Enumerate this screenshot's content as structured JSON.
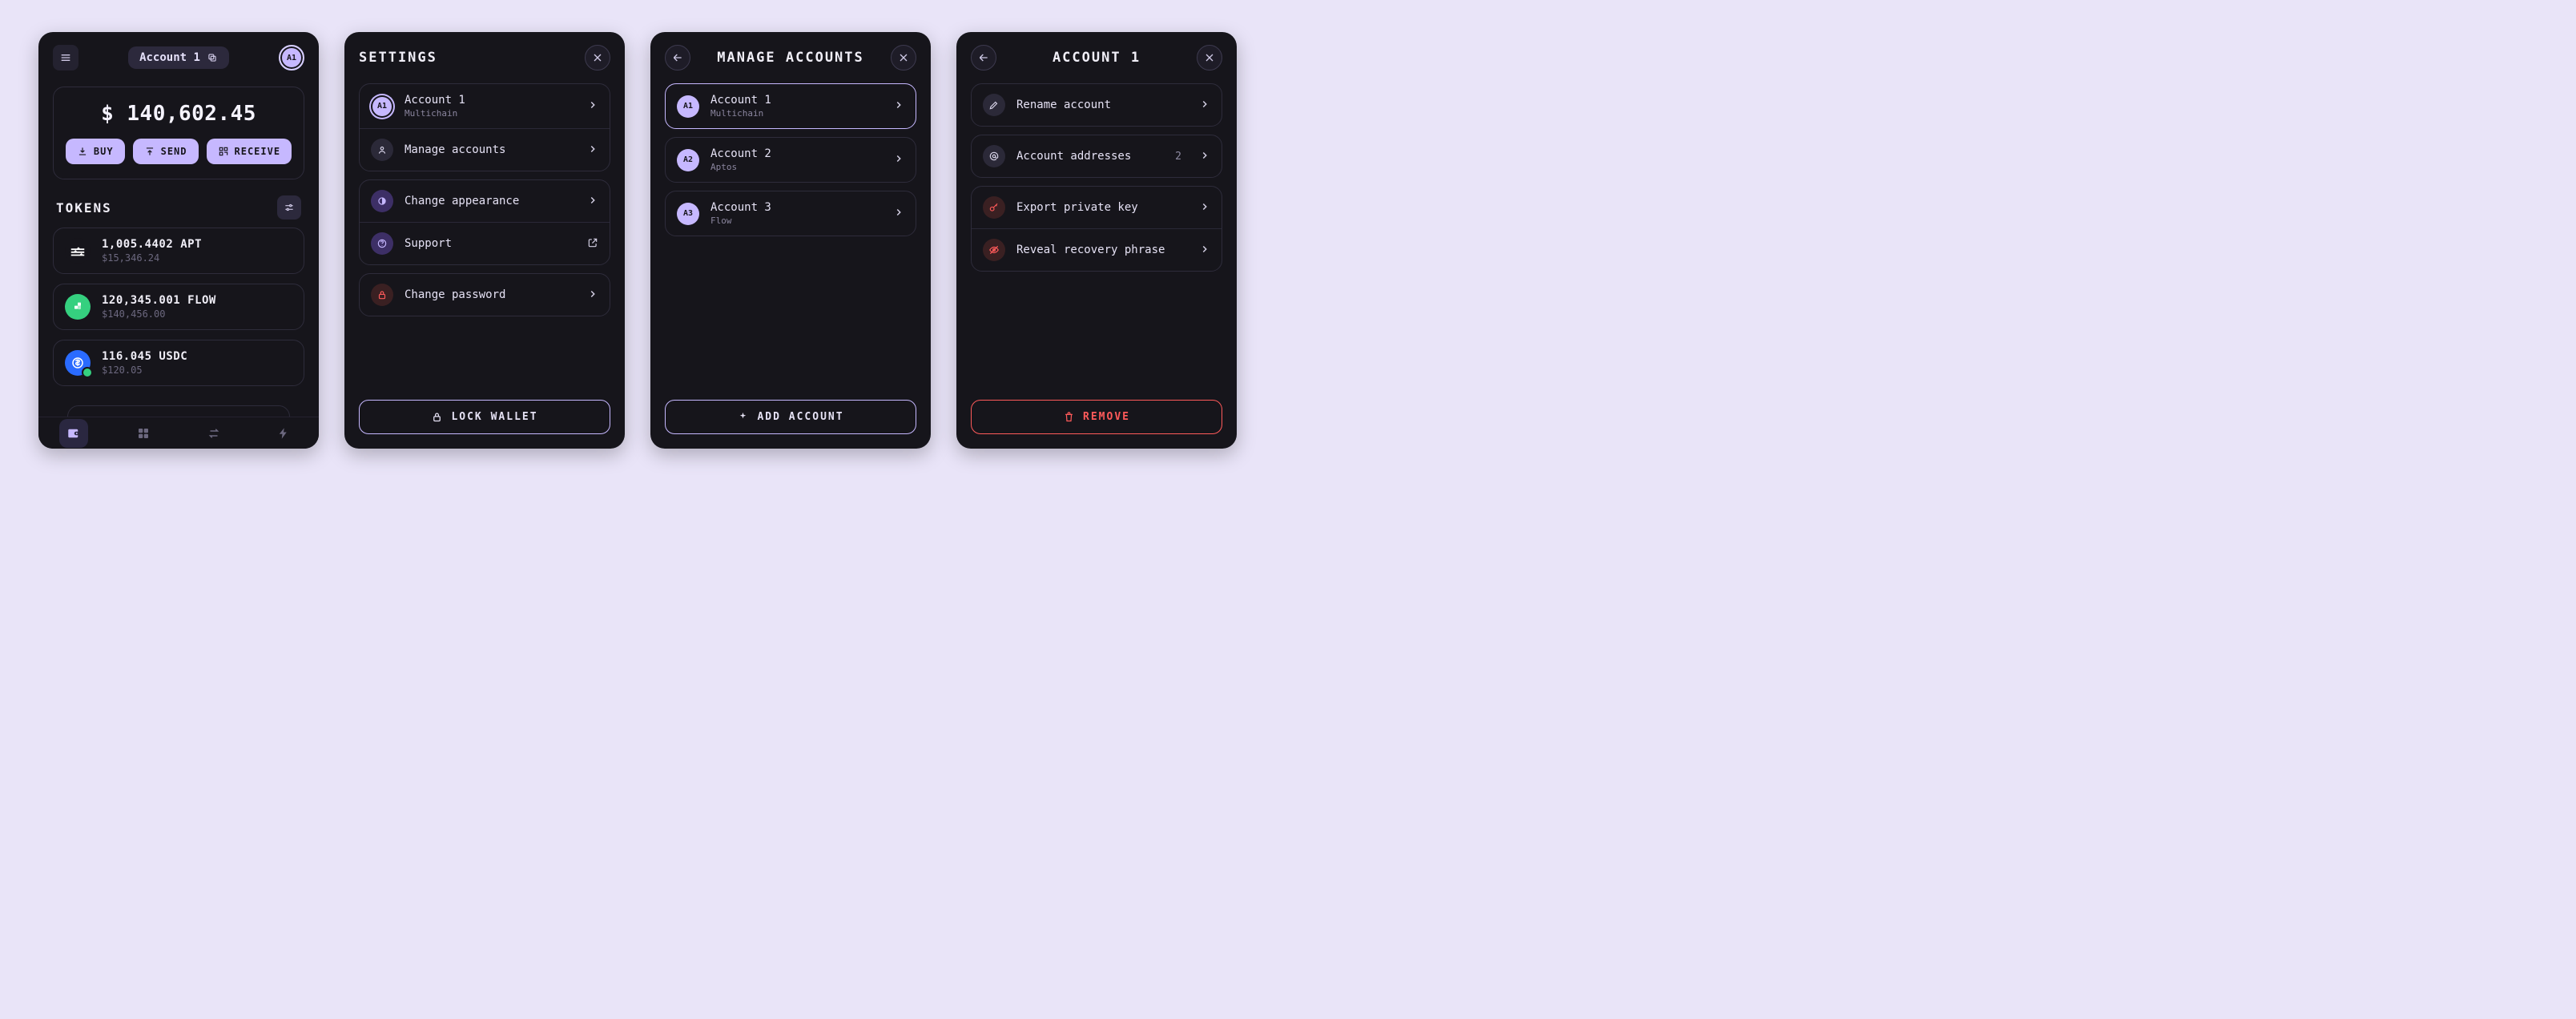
{
  "home": {
    "account_chip": "Account 1",
    "avatar": "A1",
    "balance": "$ 140,602.45",
    "buy": "BUY",
    "send": "SEND",
    "receive": "RECEIVE",
    "tokens_title": "TOKENS",
    "tokens": [
      {
        "amount": "1,005.4402 APT",
        "fiat": "$15,346.24",
        "bg": "#16151b",
        "fg": "#ffffff"
      },
      {
        "amount": "120,345.001 FLOW",
        "fiat": "$140,456.00",
        "bg": "#35d07f",
        "fg": "#ffffff"
      },
      {
        "amount": "116.045 USDC",
        "fiat": "$120.05",
        "bg": "#2a6bff",
        "fg": "#ffffff",
        "badge": true
      }
    ]
  },
  "settings": {
    "title": "SETTINGS",
    "account_name": "Account 1",
    "account_sub": "Multichain",
    "account_avatar": "A1",
    "manage": "Manage accounts",
    "appearance": "Change appearance",
    "support": "Support",
    "password": "Change password",
    "lock": "LOCK WALLET"
  },
  "manage": {
    "title": "MANAGE ACCOUNTS",
    "add": "ADD ACCOUNT",
    "accounts": [
      {
        "avatar": "A1",
        "name": "Account 1",
        "sub": "Multichain",
        "selected": true
      },
      {
        "avatar": "A2",
        "name": "Account 2",
        "sub": "Aptos"
      },
      {
        "avatar": "A3",
        "name": "Account 3",
        "sub": "Flow"
      }
    ]
  },
  "detail": {
    "title": "ACCOUNT 1",
    "rename": "Rename account",
    "addresses": "Account addresses",
    "addresses_count": "2",
    "export": "Export private key",
    "reveal": "Reveal recovery phrase",
    "remove": "REMOVE"
  }
}
